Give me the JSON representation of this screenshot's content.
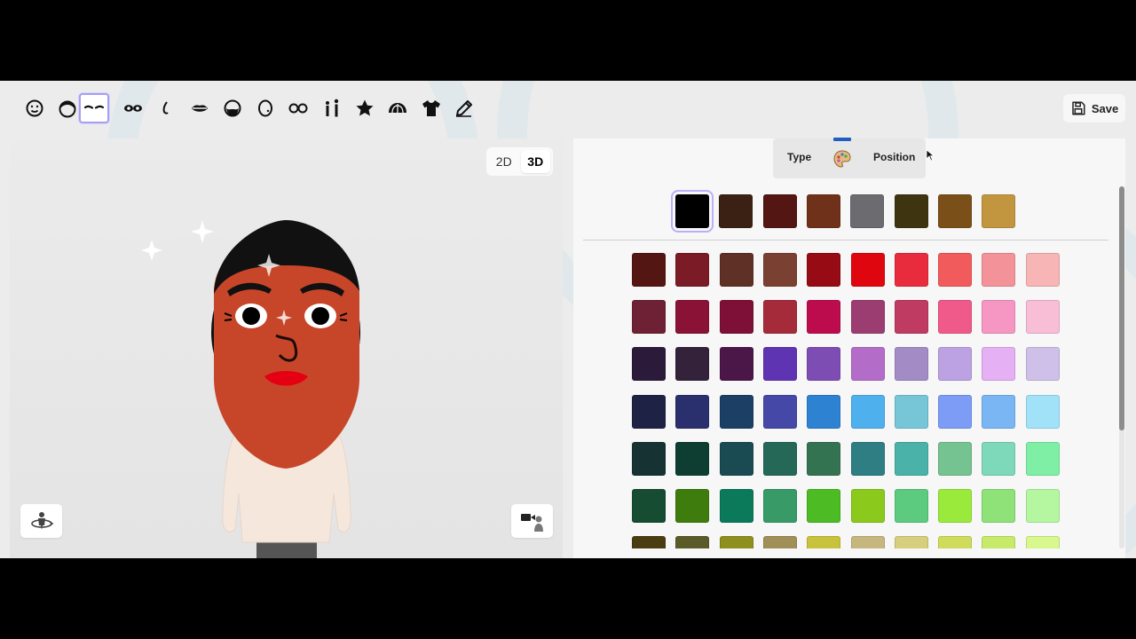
{
  "toolbar": {
    "tools": [
      {
        "name": "face-icon"
      },
      {
        "name": "hair-icon"
      },
      {
        "name": "eyebrows-icon",
        "active": true
      },
      {
        "name": "eyes-icon"
      },
      {
        "name": "nose-icon"
      },
      {
        "name": "mouth-icon"
      },
      {
        "name": "beard-icon"
      },
      {
        "name": "mole-icon"
      },
      {
        "name": "glasses-icon"
      },
      {
        "name": "body-icon"
      },
      {
        "name": "favorite-icon"
      },
      {
        "name": "headwear-icon"
      },
      {
        "name": "clothing-icon"
      },
      {
        "name": "pencil-icon"
      }
    ],
    "save_label": "Save"
  },
  "preview": {
    "toggle": {
      "option_2d": "2D",
      "option_3d": "3D",
      "selected": "3D"
    },
    "left_button_icon": "rotate-view-icon",
    "right_button_icon": "camera-pose-icon"
  },
  "panel": {
    "tabs": {
      "type_label": "Type",
      "color_tab_icon": "palette-icon",
      "position_label": "Position",
      "active": "color"
    },
    "colors": {
      "top_row": [
        "#000000",
        "#3a2114",
        "#531612",
        "#70311a",
        "#6b6b70",
        "#3f3410",
        "#7a5018",
        "#c2963f"
      ],
      "selected": "#000000",
      "grid": [
        [
          "#531612",
          "#7a1b26",
          "#5e3026",
          "#7a4133",
          "#960b14",
          "#df060f",
          "#e82c3e",
          "#f25b5b",
          "#f4929a",
          "#f7b5b5"
        ],
        [
          "#6e2134",
          "#8a1237",
          "#7e0f37",
          "#a52b3b",
          "#bd0c4e",
          "#9c3d72",
          "#bf3b61",
          "#ef5a8a",
          "#f597c2",
          "#f8bed6"
        ],
        [
          "#2b1a3a",
          "#33223a",
          "#4b1648",
          "#5f34b3",
          "#7e4db3",
          "#b36dc9",
          "#a38bc6",
          "#bca2e3",
          "#e5b0f4",
          "#cfc0ea"
        ],
        [
          "#1e2245",
          "#2a2f6e",
          "#1c3f65",
          "#4548a6",
          "#2d82d2",
          "#4fb0ee",
          "#76c6d7",
          "#7c9cf6",
          "#7ab6f4",
          "#a2e2f9"
        ],
        [
          "#163233",
          "#0d3e31",
          "#1a4b53",
          "#256858",
          "#347352",
          "#2e7e84",
          "#4ab2a8",
          "#75c391",
          "#7ed9ba",
          "#7eefa5"
        ],
        [
          "#154c32",
          "#3f7c0e",
          "#0b7a5a",
          "#389a67",
          "#4cbb24",
          "#8bc91d",
          "#5ccb80",
          "#9aea3c",
          "#8ee278",
          "#b5f7a0"
        ],
        [
          "#4b3d12",
          "#5b5b2a",
          "#8e8f1f",
          "#a18f58",
          "#c9c23d",
          "#c6b77e",
          "#d6cf7d",
          "#cfdc5b",
          "#c8ea6b",
          "#d8f78c"
        ]
      ]
    }
  }
}
